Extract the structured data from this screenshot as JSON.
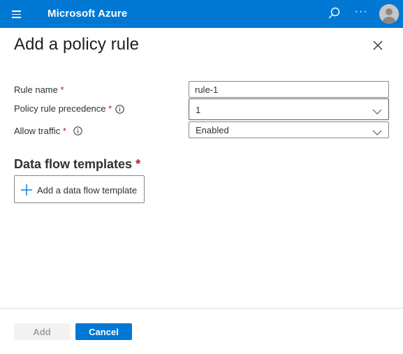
{
  "topbar": {
    "brand": "Microsoft Azure",
    "icons": [
      "menu-icon",
      "search-icon",
      "more-icon",
      "avatar"
    ],
    "more_label": "···"
  },
  "panel": {
    "title": "Add a policy rule",
    "close_icon": "close-icon"
  },
  "form": {
    "rule_name": {
      "label": "Rule name",
      "required": "*",
      "value": "rule-1"
    },
    "precedence": {
      "label": "Policy rule precedence",
      "required": "*",
      "value": "1",
      "info_icon": "info-icon"
    },
    "allow_traffic": {
      "label": "Allow traffic",
      "required": "*",
      "value": "Enabled",
      "info_icon": "info-icon"
    }
  },
  "templates": {
    "title": "Data flow templates",
    "required": "*",
    "add_button": "Add a data flow template"
  },
  "footer": {
    "add_label": "Add",
    "cancel_label": "Cancel"
  },
  "colors": {
    "accent": "#0078d4",
    "required": "#a4262c",
    "text": "#323130",
    "disabled_bg": "#f3f2f1",
    "disabled_text": "#a19f9d"
  }
}
